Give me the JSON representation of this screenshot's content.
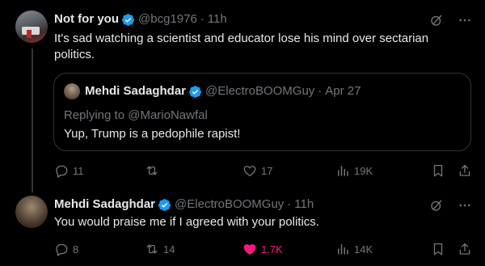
{
  "posts": [
    {
      "name": "Not for you",
      "handle": "@bcg1976",
      "dot": "·",
      "time": "11h",
      "text": "It's sad watching a scientist and educator lose his mind over sectarian politics.",
      "quote": {
        "name": "Mehdi Sadaghdar",
        "handle": "@ElectroBOOMGuy",
        "dot": "·",
        "time": "Apr 27",
        "replying_prefix": "Replying to ",
        "replying_to": "@MarioNawfal",
        "text": "Yup, Trump is a pedophile rapist!"
      },
      "stats": {
        "replies": "11",
        "reposts": "",
        "likes": "17",
        "views": "19K"
      }
    },
    {
      "name": "Mehdi Sadaghdar",
      "handle": "@ElectroBOOMGuy",
      "dot": "·",
      "time": "11h",
      "text": "You would praise me if I agreed with your politics.",
      "stats": {
        "replies": "8",
        "reposts": "14",
        "likes": "1.7K",
        "views": "14K"
      }
    }
  ],
  "colors": {
    "background": "#000000",
    "text": "#e7e9ea",
    "muted": "#71767b",
    "verified": "#1d9bf0",
    "like": "#f91880",
    "border": "#2f3336"
  },
  "icons": [
    "verified-icon",
    "grok-icon",
    "more-icon",
    "reply-icon",
    "repost-icon",
    "like-icon",
    "views-icon",
    "bookmark-icon",
    "share-icon"
  ]
}
